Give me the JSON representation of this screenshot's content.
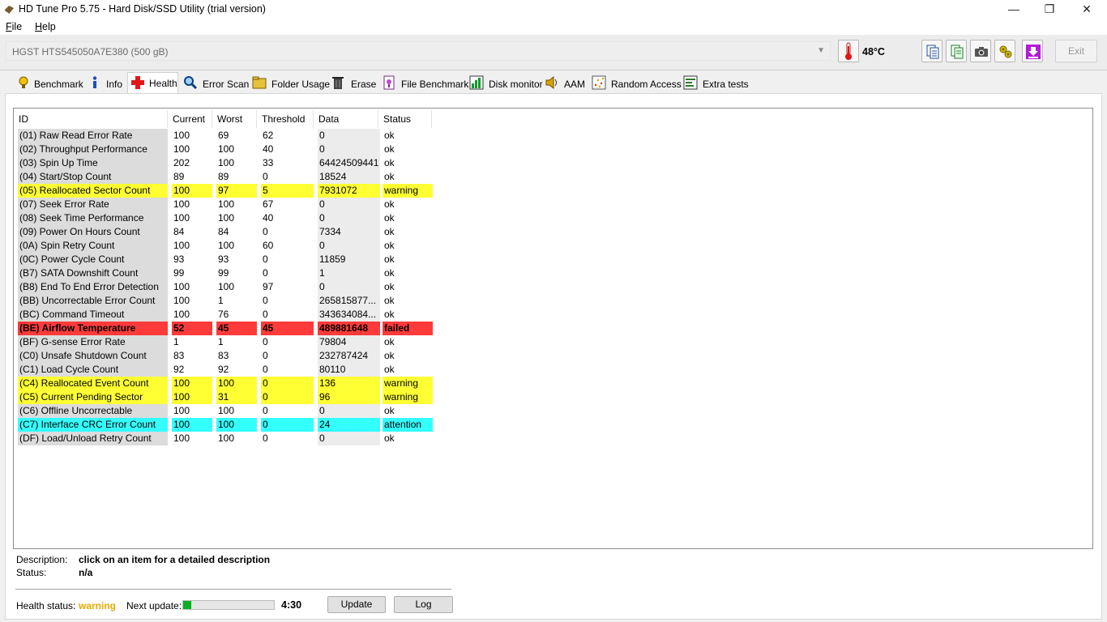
{
  "window": {
    "title": "HD Tune Pro 5.75 - Hard Disk/SSD Utility (trial version)",
    "min": "—",
    "max": "❐",
    "close": "✕"
  },
  "menu": {
    "file_u": "F",
    "file_rest": "ile",
    "help_u": "H",
    "help_rest": "elp"
  },
  "drive": {
    "name": "HGST HTS545050A7E380 (500 gB)",
    "temperature": "48°C",
    "exit_label": "Exit"
  },
  "tabs": [
    {
      "label": "Benchmark",
      "icon": "benchmark-icon"
    },
    {
      "label": "Info",
      "icon": "info-icon"
    },
    {
      "label": "Health",
      "icon": "health-cross-icon"
    },
    {
      "label": "Error Scan",
      "icon": "magnifier-icon"
    },
    {
      "label": "Folder Usage",
      "icon": "folder-icon"
    },
    {
      "label": "Erase",
      "icon": "trash-icon"
    },
    {
      "label": "File Benchmark",
      "icon": "file-benchmark-icon"
    },
    {
      "label": "Disk monitor",
      "icon": "chart-icon"
    },
    {
      "label": "AAM",
      "icon": "speaker-icon"
    },
    {
      "label": "Random Access",
      "icon": "random-access-icon"
    },
    {
      "label": "Extra tests",
      "icon": "extra-tests-icon"
    }
  ],
  "table": {
    "headers": [
      "ID",
      "Current",
      "Worst",
      "Threshold",
      "Data",
      "Status"
    ],
    "rows": [
      {
        "id": "(01) Raw Read Error Rate",
        "current": "100",
        "worst": "69",
        "threshold": "62",
        "data": "0",
        "status": "ok"
      },
      {
        "id": "(02) Throughput Performance",
        "current": "100",
        "worst": "100",
        "threshold": "40",
        "data": "0",
        "status": "ok"
      },
      {
        "id": "(03) Spin Up Time",
        "current": "202",
        "worst": "100",
        "threshold": "33",
        "data": "64424509441",
        "status": "ok"
      },
      {
        "id": "(04) Start/Stop Count",
        "current": "89",
        "worst": "89",
        "threshold": "0",
        "data": "18524",
        "status": "ok"
      },
      {
        "id": "(05) Reallocated Sector Count",
        "current": "100",
        "worst": "97",
        "threshold": "5",
        "data": "7931072",
        "status": "warning"
      },
      {
        "id": "(07) Seek Error Rate",
        "current": "100",
        "worst": "100",
        "threshold": "67",
        "data": "0",
        "status": "ok"
      },
      {
        "id": "(08) Seek Time Performance",
        "current": "100",
        "worst": "100",
        "threshold": "40",
        "data": "0",
        "status": "ok"
      },
      {
        "id": "(09) Power On Hours Count",
        "current": "84",
        "worst": "84",
        "threshold": "0",
        "data": "7334",
        "status": "ok"
      },
      {
        "id": "(0A) Spin Retry Count",
        "current": "100",
        "worst": "100",
        "threshold": "60",
        "data": "0",
        "status": "ok"
      },
      {
        "id": "(0C) Power Cycle Count",
        "current": "93",
        "worst": "93",
        "threshold": "0",
        "data": "11859",
        "status": "ok"
      },
      {
        "id": "(B7) SATA Downshift Count",
        "current": "99",
        "worst": "99",
        "threshold": "0",
        "data": "1",
        "status": "ok"
      },
      {
        "id": "(B8) End To End Error Detection",
        "current": "100",
        "worst": "100",
        "threshold": "97",
        "data": "0",
        "status": "ok"
      },
      {
        "id": "(BB) Uncorrectable Error Count",
        "current": "100",
        "worst": "1",
        "threshold": "0",
        "data": "265815877...",
        "status": "ok"
      },
      {
        "id": "(BC) Command Timeout",
        "current": "100",
        "worst": "76",
        "threshold": "0",
        "data": "343634084...",
        "status": "ok"
      },
      {
        "id": "(BE) Airflow Temperature",
        "current": "52",
        "worst": "45",
        "threshold": "45",
        "data": "489881648",
        "status": "failed"
      },
      {
        "id": "(BF) G-sense Error Rate",
        "current": "1",
        "worst": "1",
        "threshold": "0",
        "data": "79804",
        "status": "ok"
      },
      {
        "id": "(C0) Unsafe Shutdown Count",
        "current": "83",
        "worst": "83",
        "threshold": "0",
        "data": "232787424",
        "status": "ok"
      },
      {
        "id": "(C1) Load Cycle Count",
        "current": "92",
        "worst": "92",
        "threshold": "0",
        "data": "80110",
        "status": "ok"
      },
      {
        "id": "(C4) Reallocated Event Count",
        "current": "100",
        "worst": "100",
        "threshold": "0",
        "data": "136",
        "status": "warning"
      },
      {
        "id": "(C5) Current Pending Sector",
        "current": "100",
        "worst": "31",
        "threshold": "0",
        "data": "96",
        "status": "warning"
      },
      {
        "id": "(C6) Offline Uncorrectable",
        "current": "100",
        "worst": "100",
        "threshold": "0",
        "data": "0",
        "status": "ok"
      },
      {
        "id": "(C7) Interface CRC Error Count",
        "current": "100",
        "worst": "100",
        "threshold": "0",
        "data": "24",
        "status": "attention"
      },
      {
        "id": "(DF) Load/Unload Retry Count",
        "current": "100",
        "worst": "100",
        "threshold": "0",
        "data": "0",
        "status": "ok"
      }
    ]
  },
  "description": {
    "label": "Description:",
    "value": "click on an item for a detailed description",
    "status_label": "Status:",
    "status_value": "n/a"
  },
  "footer": {
    "health_label": "Health status:",
    "health_value": "warning",
    "next_update_label": "Next update:",
    "next_update_progress": 0.09,
    "countdown": "4:30",
    "update_label": "Update",
    "log_label": "Log"
  },
  "colors": {
    "warning_row": "#ffff33",
    "failed_row": "#ff3a3a",
    "attention_row": "#33ffff",
    "progress": "#06b025",
    "health_warning_text": "#e8a800"
  }
}
